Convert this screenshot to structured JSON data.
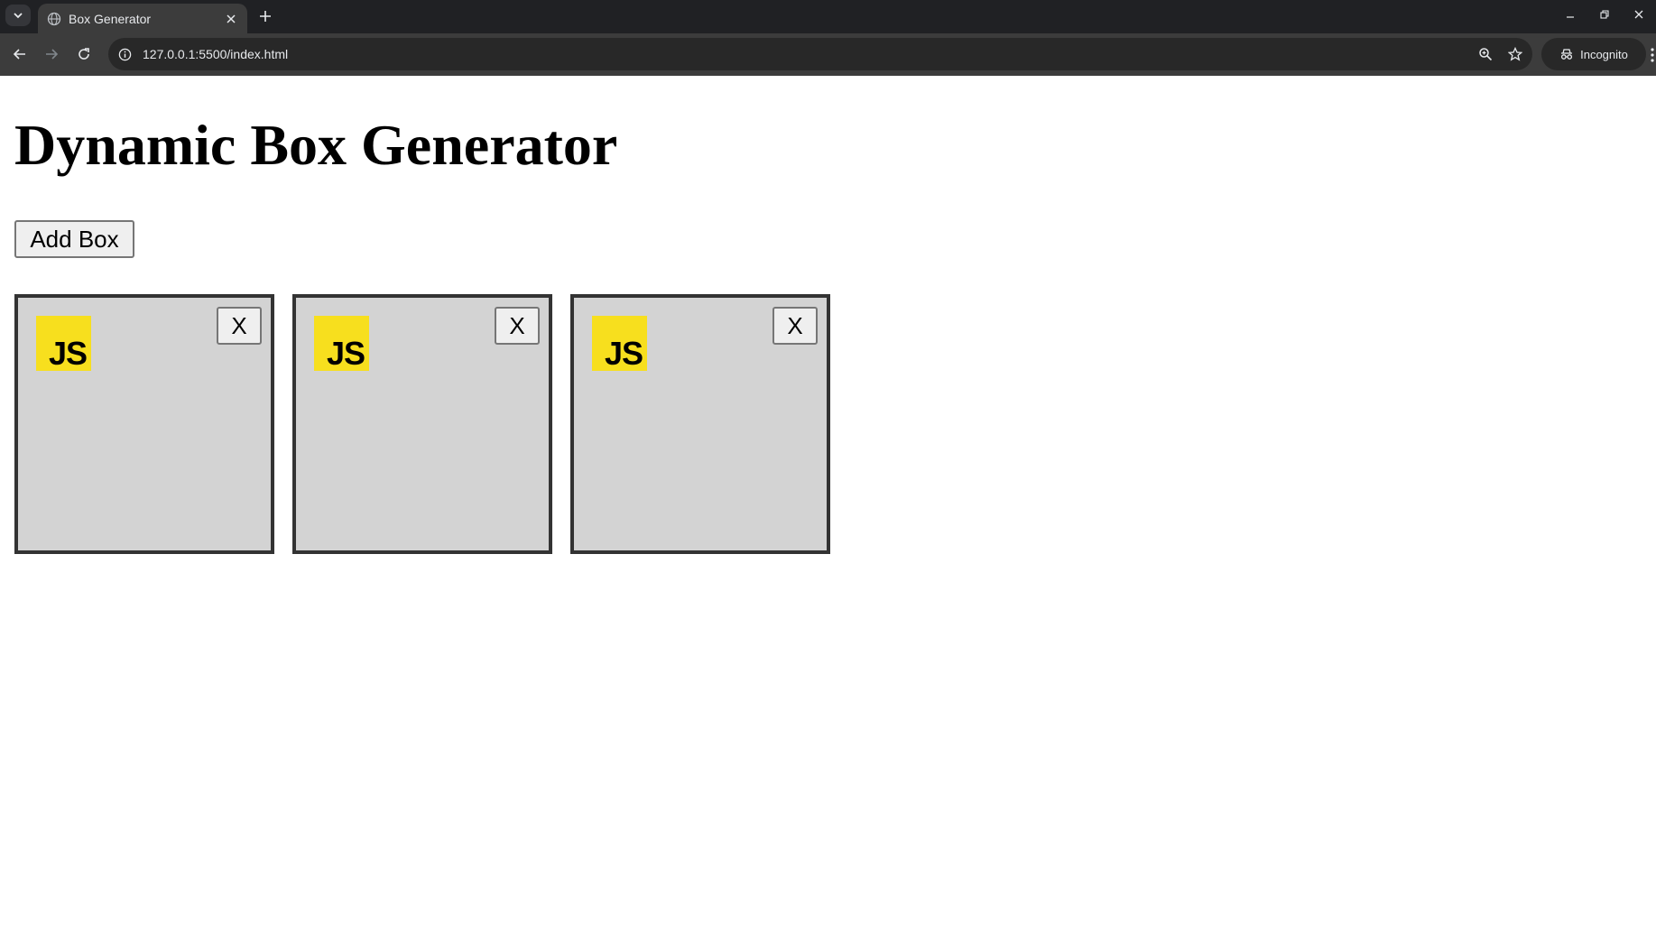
{
  "browser": {
    "tab_title": "Box Generator",
    "url": "127.0.0.1:5500/index.html",
    "incognito_label": "Incognito",
    "icons": {
      "tab_search": "chevron-down-icon",
      "favicon": "globe-icon",
      "tab_close": "close-icon",
      "new_tab": "plus-icon",
      "back": "arrow-left-icon",
      "forward": "arrow-right-icon",
      "reload": "reload-icon",
      "site_info": "info-icon",
      "zoom": "zoom-icon",
      "bookmark": "star-icon",
      "incognito": "incognito-icon",
      "menu": "kebab-menu-icon"
    }
  },
  "page": {
    "title": "Dynamic Box Generator",
    "add_button_label": "Add Box",
    "boxes": [
      {
        "logo_text": "JS",
        "close_label": "X"
      },
      {
        "logo_text": "JS",
        "close_label": "X"
      },
      {
        "logo_text": "JS",
        "close_label": "X"
      }
    ]
  },
  "colors": {
    "box_background": "#d3d3d3",
    "box_border": "#333333",
    "js_logo_yellow": "#f7df1e"
  }
}
